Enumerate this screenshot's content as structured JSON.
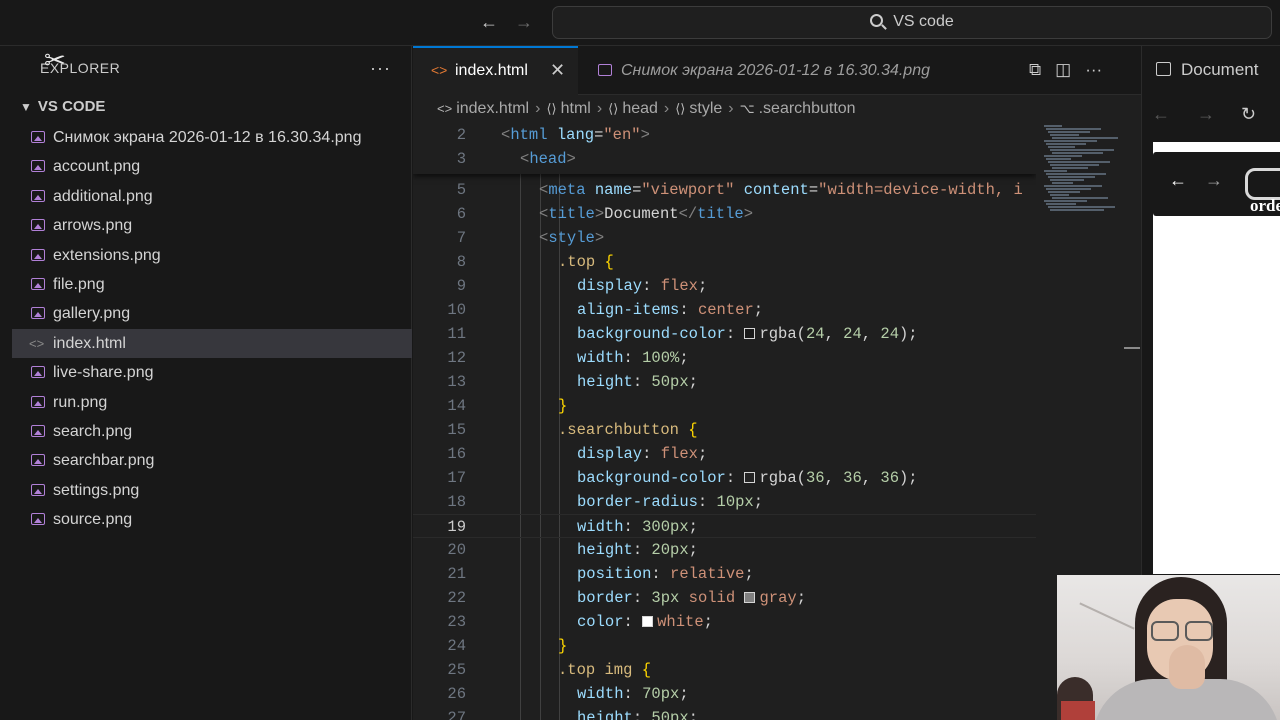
{
  "titlebar": {
    "search_label": "VS code",
    "back_icon": "arrow-left-icon",
    "forward_icon": "arrow-right-icon"
  },
  "sidebar": {
    "header": "EXPLORER",
    "folder": "VS CODE",
    "files": [
      {
        "name": "Снимок экрана 2026-01-12 в 16.30.34.png",
        "icon": "image-file-icon"
      },
      {
        "name": "account.png",
        "icon": "image-file-icon"
      },
      {
        "name": "additional.png",
        "icon": "image-file-icon"
      },
      {
        "name": "arrows.png",
        "icon": "image-file-icon"
      },
      {
        "name": "extensions.png",
        "icon": "image-file-icon"
      },
      {
        "name": "file.png",
        "icon": "image-file-icon"
      },
      {
        "name": "gallery.png",
        "icon": "image-file-icon"
      },
      {
        "name": "index.html",
        "icon": "html-file-icon",
        "active": true
      },
      {
        "name": "live-share.png",
        "icon": "image-file-icon"
      },
      {
        "name": "run.png",
        "icon": "image-file-icon"
      },
      {
        "name": "search.png",
        "icon": "image-file-icon"
      },
      {
        "name": "searchbar.png",
        "icon": "image-file-icon"
      },
      {
        "name": "settings.png",
        "icon": "image-file-icon"
      },
      {
        "name": "source.png",
        "icon": "image-file-icon"
      }
    ]
  },
  "tabs": {
    "active": "index.html",
    "second": "Снимок экрана 2026-01-12 в 16.30.34.png"
  },
  "breadcrumbs": [
    "index.html",
    "html",
    "head",
    "style",
    ".searchbutton"
  ],
  "editor": {
    "current_line": 19,
    "sticky_lines": [
      {
        "n": 2,
        "indent": 0,
        "tokens": [
          [
            "t-punc",
            "<"
          ],
          [
            "t-tag",
            "html"
          ],
          [
            "t-text",
            " "
          ],
          [
            "t-attr",
            "lang"
          ],
          [
            "t-text",
            "="
          ],
          [
            "t-str",
            "\"en\""
          ],
          [
            "t-punc",
            ">"
          ]
        ]
      },
      {
        "n": 3,
        "indent": 1,
        "tokens": [
          [
            "t-punc",
            "<"
          ],
          [
            "t-tag",
            "head"
          ],
          [
            "t-punc",
            ">"
          ]
        ]
      }
    ],
    "lines": [
      {
        "n": 5,
        "indent": 2,
        "tokens": [
          [
            "t-punc",
            "<"
          ],
          [
            "t-tag",
            "meta"
          ],
          [
            "t-text",
            " "
          ],
          [
            "t-attr",
            "name"
          ],
          [
            "t-text",
            "="
          ],
          [
            "t-str",
            "\"viewport\""
          ],
          [
            "t-text",
            " "
          ],
          [
            "t-attr",
            "content"
          ],
          [
            "t-text",
            "="
          ],
          [
            "t-str",
            "\"width=device-width, i"
          ]
        ]
      },
      {
        "n": 6,
        "indent": 2,
        "tokens": [
          [
            "t-punc",
            "<"
          ],
          [
            "t-tag",
            "title"
          ],
          [
            "t-punc",
            ">"
          ],
          [
            "t-text",
            "Document"
          ],
          [
            "t-punc",
            "</"
          ],
          [
            "t-tag",
            "title"
          ],
          [
            "t-punc",
            ">"
          ]
        ]
      },
      {
        "n": 7,
        "indent": 2,
        "tokens": [
          [
            "t-punc",
            "<"
          ],
          [
            "t-tag",
            "style"
          ],
          [
            "t-punc",
            ">"
          ]
        ]
      },
      {
        "n": 8,
        "indent": 3,
        "tokens": [
          [
            "t-sel",
            ".top"
          ],
          [
            "t-text",
            " "
          ],
          [
            "t-brace",
            "{"
          ]
        ]
      },
      {
        "n": 9,
        "indent": 4,
        "tokens": [
          [
            "t-prop",
            "display"
          ],
          [
            "t-text",
            ": "
          ],
          [
            "t-val",
            "flex"
          ],
          [
            "t-text",
            ";"
          ]
        ]
      },
      {
        "n": 10,
        "indent": 4,
        "tokens": [
          [
            "t-prop",
            "align-items"
          ],
          [
            "t-text",
            ": "
          ],
          [
            "t-val",
            "center"
          ],
          [
            "t-text",
            ";"
          ]
        ]
      },
      {
        "n": 11,
        "indent": 4,
        "tokens": [
          [
            "t-prop",
            "background-color"
          ],
          [
            "t-text",
            ": "
          ],
          [
            "swatch",
            "#181818"
          ],
          [
            "t-text",
            "rgba("
          ],
          [
            "t-num",
            "24"
          ],
          [
            "t-text",
            ", "
          ],
          [
            "t-num",
            "24"
          ],
          [
            "t-text",
            ", "
          ],
          [
            "t-num",
            "24"
          ],
          [
            "t-text",
            ");"
          ]
        ]
      },
      {
        "n": 12,
        "indent": 4,
        "tokens": [
          [
            "t-prop",
            "width"
          ],
          [
            "t-text",
            ": "
          ],
          [
            "t-num",
            "100%"
          ],
          [
            "t-text",
            ";"
          ]
        ]
      },
      {
        "n": 13,
        "indent": 4,
        "tokens": [
          [
            "t-prop",
            "height"
          ],
          [
            "t-text",
            ": "
          ],
          [
            "t-num",
            "50px"
          ],
          [
            "t-text",
            ";"
          ]
        ]
      },
      {
        "n": 14,
        "indent": 3,
        "tokens": [
          [
            "t-brace",
            "}"
          ]
        ]
      },
      {
        "n": 15,
        "indent": 3,
        "tokens": [
          [
            "t-sel",
            ".searchbutton"
          ],
          [
            "t-text",
            " "
          ],
          [
            "t-brace",
            "{"
          ]
        ]
      },
      {
        "n": 16,
        "indent": 4,
        "tokens": [
          [
            "t-prop",
            "display"
          ],
          [
            "t-text",
            ": "
          ],
          [
            "t-val",
            "flex"
          ],
          [
            "t-text",
            ";"
          ]
        ]
      },
      {
        "n": 17,
        "indent": 4,
        "tokens": [
          [
            "t-prop",
            "background-color"
          ],
          [
            "t-text",
            ": "
          ],
          [
            "swatch",
            "#242424"
          ],
          [
            "t-text",
            "rgba("
          ],
          [
            "t-num",
            "36"
          ],
          [
            "t-text",
            ", "
          ],
          [
            "t-num",
            "36"
          ],
          [
            "t-text",
            ", "
          ],
          [
            "t-num",
            "36"
          ],
          [
            "t-text",
            ");"
          ]
        ]
      },
      {
        "n": 18,
        "indent": 4,
        "tokens": [
          [
            "t-prop",
            "border-radius"
          ],
          [
            "t-text",
            ": "
          ],
          [
            "t-num",
            "10px"
          ],
          [
            "t-text",
            ";"
          ]
        ]
      },
      {
        "n": 19,
        "indent": 4,
        "tokens": [
          [
            "t-prop",
            "width"
          ],
          [
            "t-text",
            ": "
          ],
          [
            "t-num",
            "300px"
          ],
          [
            "t-text",
            ";"
          ]
        ]
      },
      {
        "n": 20,
        "indent": 4,
        "tokens": [
          [
            "t-prop",
            "height"
          ],
          [
            "t-text",
            ": "
          ],
          [
            "t-num",
            "20px"
          ],
          [
            "t-text",
            ";"
          ]
        ]
      },
      {
        "n": 21,
        "indent": 4,
        "tokens": [
          [
            "t-prop",
            "position"
          ],
          [
            "t-text",
            ": "
          ],
          [
            "t-val",
            "relative"
          ],
          [
            "t-text",
            ";"
          ]
        ]
      },
      {
        "n": 22,
        "indent": 4,
        "tokens": [
          [
            "t-prop",
            "border"
          ],
          [
            "t-text",
            ": "
          ],
          [
            "t-num",
            "3px"
          ],
          [
            "t-text",
            " "
          ],
          [
            "t-val",
            "solid"
          ],
          [
            "t-text",
            " "
          ],
          [
            "swatch",
            "#808080"
          ],
          [
            "t-val",
            "gray"
          ],
          [
            "t-text",
            ";"
          ]
        ]
      },
      {
        "n": 23,
        "indent": 4,
        "tokens": [
          [
            "t-prop",
            "color"
          ],
          [
            "t-text",
            ": "
          ],
          [
            "swatch",
            "#ffffff"
          ],
          [
            "t-val",
            "white"
          ],
          [
            "t-text",
            ";"
          ]
        ]
      },
      {
        "n": 24,
        "indent": 3,
        "tokens": [
          [
            "t-brace",
            "}"
          ]
        ]
      },
      {
        "n": 25,
        "indent": 3,
        "tokens": [
          [
            "t-sel",
            ".top img"
          ],
          [
            "t-text",
            " "
          ],
          [
            "t-brace",
            "{"
          ]
        ]
      },
      {
        "n": 26,
        "indent": 4,
        "tokens": [
          [
            "t-prop",
            "width"
          ],
          [
            "t-text",
            ": "
          ],
          [
            "t-num",
            "70px"
          ],
          [
            "t-text",
            ";"
          ]
        ]
      },
      {
        "n": 27,
        "indent": 4,
        "tokens": [
          [
            "t-prop",
            "height"
          ],
          [
            "t-text",
            ": "
          ],
          [
            "t-num",
            "50px"
          ],
          [
            "t-text",
            ";"
          ]
        ]
      }
    ]
  },
  "browser": {
    "tab_title": "Document",
    "preview_text": "orde"
  }
}
